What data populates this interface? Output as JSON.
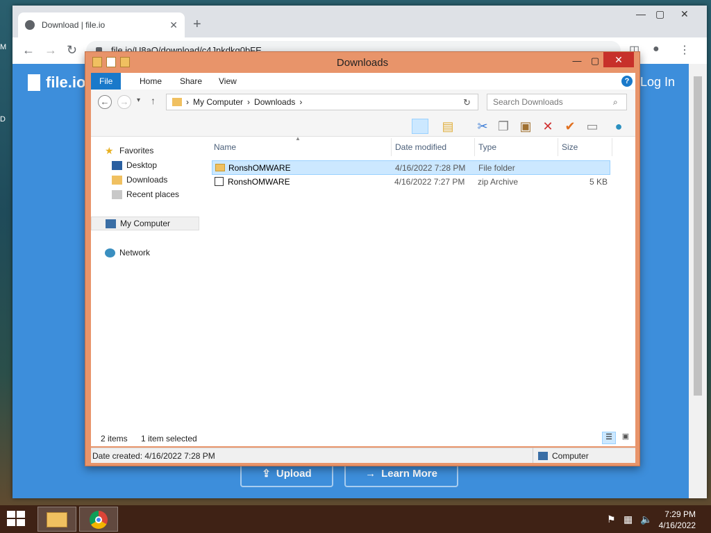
{
  "desktop": {
    "labels": [
      "M",
      "D"
    ]
  },
  "browser": {
    "tab_title": "Download | file.io",
    "url": "file.io/U8aQ/download/c4Jnkdkg0bFE",
    "page": {
      "logo_text": "file.io",
      "login_text": "Log In",
      "upload_button": "Upload",
      "learn_more_button": "Learn More"
    }
  },
  "explorer": {
    "title": "Downloads",
    "ribbon_tabs": [
      "File",
      "Home",
      "Share",
      "View"
    ],
    "breadcrumb": [
      "My Computer",
      "Downloads"
    ],
    "search_placeholder": "Search Downloads",
    "nav": {
      "favorites": "Favorites",
      "desktop": "Desktop",
      "downloads": "Downloads",
      "recent": "Recent places",
      "computer": "My Computer",
      "network": "Network"
    },
    "columns": [
      "Name",
      "Date modified",
      "Type",
      "Size"
    ],
    "files": [
      {
        "name": "RonshOMWARE",
        "date": "4/16/2022 7:28 PM",
        "type": "File folder",
        "size": ""
      },
      {
        "name": "RonshOMWARE",
        "date": "4/16/2022 7:27 PM",
        "type": "zip Archive",
        "size": "5 KB"
      }
    ],
    "status": {
      "items": "2 items",
      "selected": "1 item selected"
    },
    "details": {
      "date_created": "Date created: 4/16/2022 7:28 PM",
      "location": "Computer"
    }
  },
  "taskbar": {
    "time": "7:29 PM",
    "date": "4/16/2022"
  }
}
